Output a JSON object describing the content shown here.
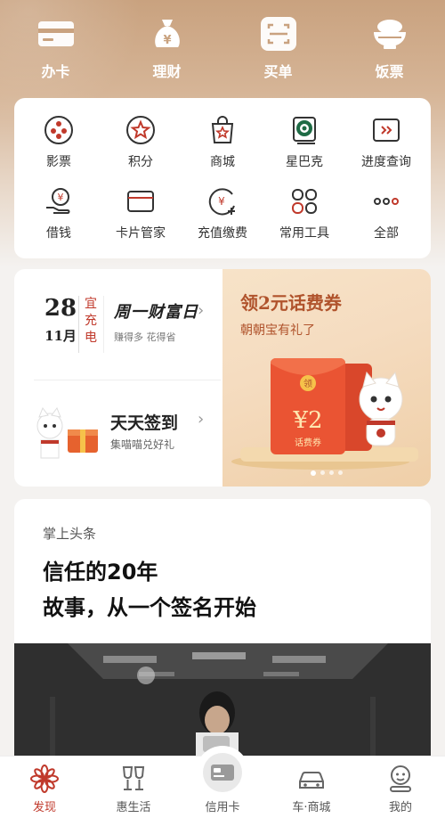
{
  "top_shortcuts": [
    {
      "label": "办卡",
      "icon": "card-icon"
    },
    {
      "label": "理财",
      "icon": "money-bag-icon"
    },
    {
      "label": "买单",
      "icon": "scan-icon"
    },
    {
      "label": "饭票",
      "icon": "rice-bowl-icon"
    }
  ],
  "services": [
    {
      "label": "影票",
      "icon": "film-reel-icon"
    },
    {
      "label": "积分",
      "icon": "points-star-icon"
    },
    {
      "label": "商城",
      "icon": "shopping-bag-icon"
    },
    {
      "label": "星巴克",
      "icon": "starbucks-icon"
    },
    {
      "label": "进度查询",
      "icon": "progress-icon"
    },
    {
      "label": "借钱",
      "icon": "loan-icon"
    },
    {
      "label": "卡片管家",
      "icon": "card-manager-icon"
    },
    {
      "label": "充值缴费",
      "icon": "recharge-icon"
    },
    {
      "label": "常用工具",
      "icon": "tools-icon"
    },
    {
      "label": "全部",
      "icon": "more-dots-icon"
    }
  ],
  "promo": {
    "date_day": "28",
    "date_month": "11月",
    "almanac": "宜充电",
    "fortune_title": "周一财富日",
    "fortune_sub": "赚得多 花得省",
    "sign_title": "天天签到",
    "sign_sub": "集喵喵兑好礼",
    "banner_title": "领2元话费券",
    "banner_sub": "朝朝宝有礼了",
    "coupon_amount": "¥2",
    "coupon_label": "话费券",
    "envelope_badge": "领",
    "carousel_count": 4,
    "carousel_active": 1
  },
  "news": {
    "source": "掌上头条",
    "title_line1": "信任的20年",
    "title_line2": "故事，从一个签名开始"
  },
  "tabbar": [
    {
      "label": "发现",
      "icon": "discover-flower-icon",
      "active": true
    },
    {
      "label": "惠生活",
      "icon": "cheers-icon",
      "active": false
    },
    {
      "label": "信用卡",
      "icon": "credit-card-icon",
      "active": false
    },
    {
      "label": "车·商城",
      "icon": "car-icon",
      "active": false
    },
    {
      "label": "我的",
      "icon": "profile-icon",
      "active": false
    }
  ],
  "colors": {
    "accent": "#c0392b",
    "gold": "#c9a27f",
    "banner_text": "#b0532c"
  }
}
